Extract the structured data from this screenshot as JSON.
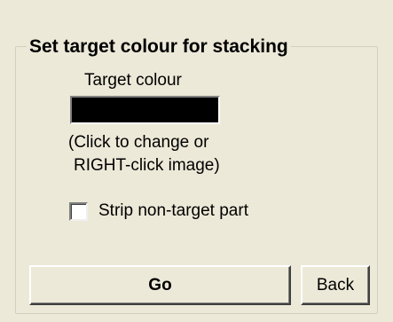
{
  "group": {
    "title": "Set target colour for stacking"
  },
  "target": {
    "label": "Target colour",
    "swatch_color": "#000000",
    "hint_line1": "(Click to change or",
    "hint_line2": "RIGHT-click image)"
  },
  "strip_option": {
    "label": "Strip non-target part",
    "checked": false
  },
  "buttons": {
    "go_label": "Go",
    "back_label": "Back"
  }
}
